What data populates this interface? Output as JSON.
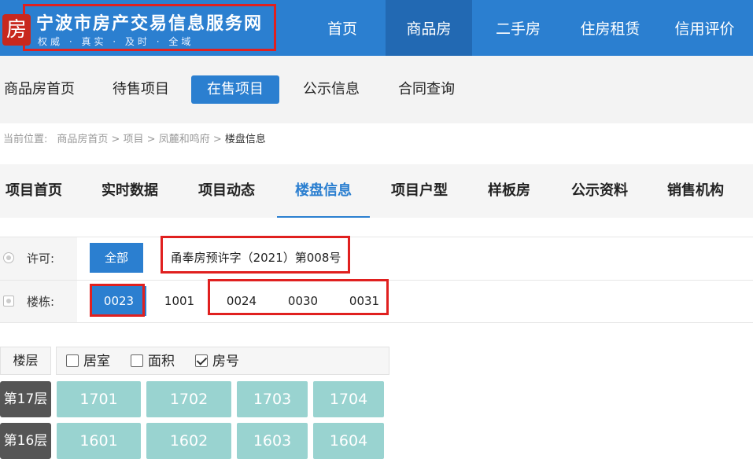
{
  "site": {
    "logo_char": "房",
    "title": "宁波市房产交易信息服务网",
    "slogan": "权威 · 真实 · 及时 · 全域"
  },
  "topnav": [
    {
      "label": "首页",
      "active": false
    },
    {
      "label": "商品房",
      "active": true
    },
    {
      "label": "二手房",
      "active": false
    },
    {
      "label": "住房租赁",
      "active": false
    },
    {
      "label": "信用评价",
      "active": false
    }
  ],
  "subnav": [
    {
      "label": "商品房首页",
      "active": false
    },
    {
      "label": "待售项目",
      "active": false
    },
    {
      "label": "在售项目",
      "active": true
    },
    {
      "label": "公示信息",
      "active": false
    },
    {
      "label": "合同查询",
      "active": false
    }
  ],
  "breadcrumb": {
    "prefix": "当前位置:",
    "path": "商品房首页 > 项目 > 凤麓和鸣府 >",
    "current": "楼盘信息"
  },
  "tabs": [
    {
      "label": "项目首页",
      "active": false
    },
    {
      "label": "实时数据",
      "active": false
    },
    {
      "label": "项目动态",
      "active": false
    },
    {
      "label": "楼盘信息",
      "active": true
    },
    {
      "label": "项目户型",
      "active": false
    },
    {
      "label": "样板房",
      "active": false
    },
    {
      "label": "公示资料",
      "active": false
    },
    {
      "label": "销售机构",
      "active": false
    }
  ],
  "filters": {
    "permit": {
      "label": "许可:",
      "options": [
        "全部",
        "甬奉房预许字（2021）第008号"
      ]
    },
    "building": {
      "label": "楼栋:",
      "options": [
        "0023",
        "1001",
        "0024",
        "0030",
        "0031"
      ]
    }
  },
  "grid": {
    "floor_header": "楼层",
    "legend": [
      {
        "label": "居室",
        "checked": false
      },
      {
        "label": "面积",
        "checked": false
      },
      {
        "label": "房号",
        "checked": true
      }
    ],
    "floors": [
      {
        "label": "第17层",
        "rooms": [
          "1701",
          "1702",
          "1703",
          "1704"
        ]
      },
      {
        "label": "第16层",
        "rooms": [
          "1601",
          "1602",
          "1603",
          "1604"
        ]
      }
    ]
  },
  "colors": {
    "primary": "#2b7fd0",
    "highlight_frame": "#e0201f",
    "room_available": "#99d3d0",
    "floor_label_bg": "#555555"
  }
}
